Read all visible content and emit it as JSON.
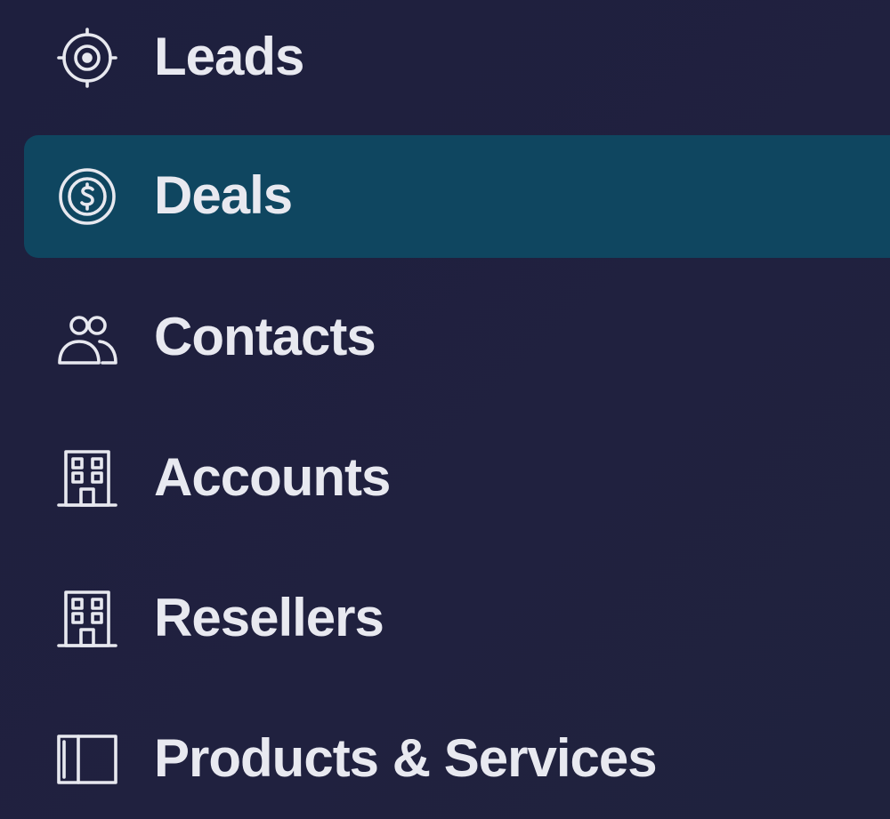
{
  "sidebar": {
    "items": [
      {
        "label": "Leads",
        "icon": "target-icon",
        "active": false
      },
      {
        "label": "Deals",
        "icon": "dollar-circle-icon",
        "active": true
      },
      {
        "label": "Contacts",
        "icon": "users-icon",
        "active": false
      },
      {
        "label": "Accounts",
        "icon": "building-icon",
        "active": false
      },
      {
        "label": "Resellers",
        "icon": "building-icon",
        "active": false
      },
      {
        "label": "Products & Services",
        "icon": "panel-icon",
        "active": false
      }
    ]
  },
  "colors": {
    "background": "#1f2040",
    "active_background": "#0f4660",
    "text": "#e7e8ef"
  }
}
